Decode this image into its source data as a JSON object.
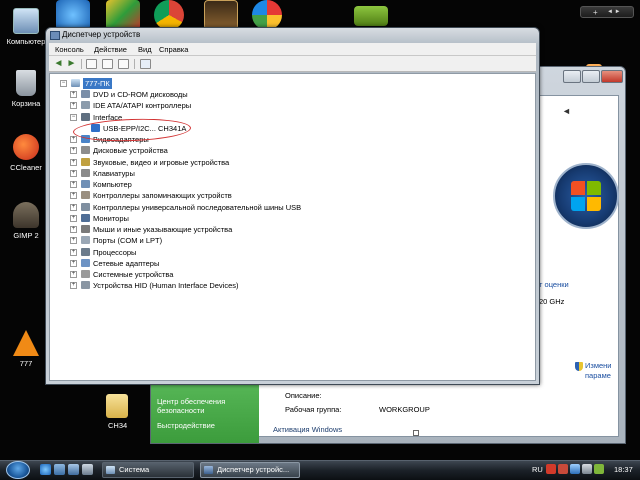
{
  "desktop": {
    "icons": [
      {
        "label": "Компьютер"
      },
      {
        "label": "Корзина"
      },
      {
        "label": "CCleaner"
      },
      {
        "label": "GIMP 2"
      },
      {
        "label": "777"
      },
      {
        "label": "CH34"
      }
    ]
  },
  "gadget_bar": {
    "add_label": "+",
    "nav_label": "◄ ►"
  },
  "system_window": {
    "text": {
      "rating_link": "т оценки",
      "cpu_speed": "20 GHz",
      "change_params_1": "Измени",
      "change_params_2": "параме",
      "description_label": "Описание:",
      "workgroup_label": "Рабочая группа:",
      "workgroup_value": "WORKGROUP",
      "activation_label": "Активация Windows"
    },
    "left_pane": {
      "security_center_1": "Центр обеспечения",
      "security_center_2": "безопасности",
      "performance": "Быстродействие"
    }
  },
  "device_manager": {
    "title": "Диспетчер устройств",
    "menu": [
      "Консоль",
      "Действие",
      "Вид",
      "Справка"
    ],
    "tree": {
      "root": "777-ПК",
      "items": [
        {
          "label": "DVD и CD-ROM дисководы",
          "expander": "+"
        },
        {
          "label": "IDE ATA/ATAPI контроллеры",
          "expander": "+"
        },
        {
          "label": "Interface",
          "expander": "−"
        },
        {
          "label": "USB-EPP/I2C... CH341A",
          "expander": ""
        },
        {
          "label": "Видеоадаптеры",
          "expander": "+"
        },
        {
          "label": "Дисковые устройства",
          "expander": "+"
        },
        {
          "label": "Звуковые, видео и игровые устройства",
          "expander": "+"
        },
        {
          "label": "Клавиатуры",
          "expander": "+"
        },
        {
          "label": "Компьютер",
          "expander": "+"
        },
        {
          "label": "Контроллеры запоминающих устройств",
          "expander": "+"
        },
        {
          "label": "Контроллеры универсальной последовательной шины USB",
          "expander": "+"
        },
        {
          "label": "Мониторы",
          "expander": "+"
        },
        {
          "label": "Мыши и иные указывающие устройства",
          "expander": "+"
        },
        {
          "label": "Порты (COM и LPT)",
          "expander": "+"
        },
        {
          "label": "Процессоры",
          "expander": "+"
        },
        {
          "label": "Сетевые адаптеры",
          "expander": "+"
        },
        {
          "label": "Системные устройства",
          "expander": "+"
        },
        {
          "label": "Устройства HID (Human Interface Devices)",
          "expander": "+"
        }
      ]
    }
  },
  "taskbar": {
    "tasks": [
      {
        "label": "Система"
      },
      {
        "label": "Диспетчер устройс..."
      }
    ],
    "tray": {
      "language": "RU",
      "time": "18:37"
    }
  }
}
